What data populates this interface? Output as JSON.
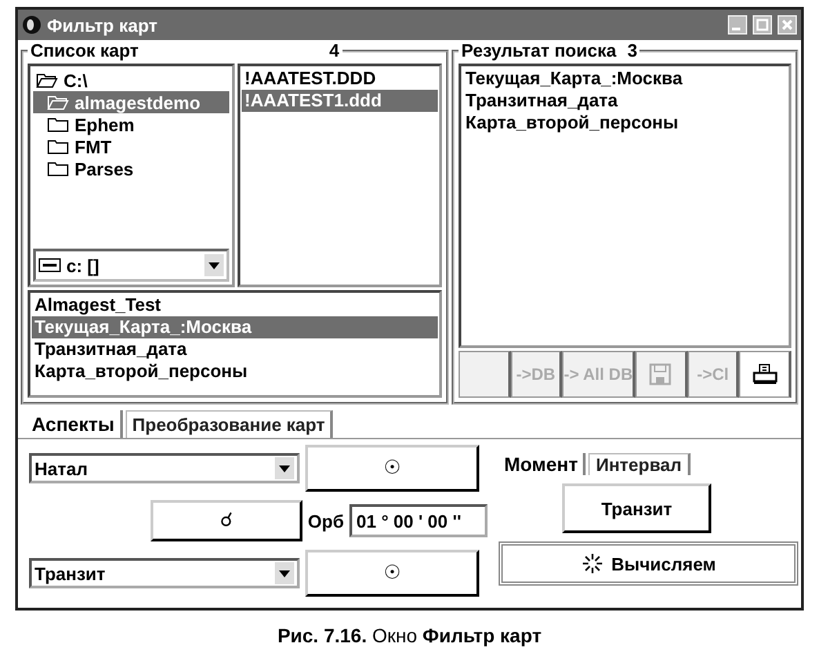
{
  "window": {
    "title": "Фильтр карт"
  },
  "chart_list": {
    "title": "Список карт",
    "count": "4",
    "folders": [
      {
        "label": "C:\\",
        "kind": "open",
        "selected": false
      },
      {
        "label": "almagestdemo",
        "kind": "open",
        "selected": true
      },
      {
        "label": "Ephem",
        "kind": "closed",
        "selected": false
      },
      {
        "label": "FMT",
        "kind": "closed",
        "selected": false
      },
      {
        "label": "Parses",
        "kind": "closed",
        "selected": false
      }
    ],
    "drive": "c: []",
    "files": [
      {
        "label": "!AAATEST.DDD",
        "selected": false
      },
      {
        "label": "!AAATEST1.ddd",
        "selected": true
      }
    ],
    "charts": [
      {
        "label": "Almagest_Test",
        "selected": false
      },
      {
        "label": "Текущая_Карта_:Москва",
        "selected": true
      },
      {
        "label": "Транзитная_дата",
        "selected": false
      },
      {
        "label": "Карта_второй_персоны",
        "selected": false
      }
    ]
  },
  "search_result": {
    "title": "Результат поиска",
    "count": "3",
    "items": [
      "Текущая_Карта_:Москва",
      "Транзитная_дата",
      "Карта_второй_персоны"
    ],
    "toolbar": [
      {
        "kind": "blank",
        "disabled": true
      },
      {
        "kind": "text",
        "label": "->DB",
        "disabled": true
      },
      {
        "kind": "text",
        "label": "-> All DB",
        "disabled": true
      },
      {
        "kind": "save",
        "disabled": true
      },
      {
        "kind": "text",
        "label": "->Cl",
        "disabled": true
      },
      {
        "kind": "print",
        "disabled": false
      }
    ]
  },
  "tabs": [
    {
      "label": "Аспекты",
      "selected": true
    },
    {
      "label": "Преобразование карт",
      "selected": false
    }
  ],
  "aspects": {
    "first": {
      "value": "Натал",
      "planet": "☉"
    },
    "aspect": "☌",
    "orb_label": "Орб",
    "orb_value": "01 ° 00 ' 00 ''",
    "second": {
      "value": "Транзит",
      "planet": "☉"
    }
  },
  "mode_tabs": [
    {
      "label": "Момент",
      "selected": true
    },
    {
      "label": "Интервал",
      "selected": false
    }
  ],
  "transit_button": "Транзит",
  "compute_button": "Вычисляем",
  "caption": "**Рис. 7.16.** Окно **Фильтр карт**"
}
